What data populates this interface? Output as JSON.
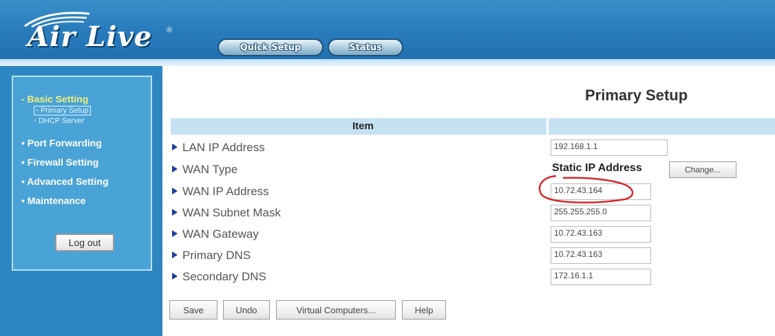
{
  "header": {
    "logo_text": "Air Live",
    "logo_reg": "®",
    "nav": [
      {
        "label": "Quick Setup"
      },
      {
        "label": "Status"
      }
    ]
  },
  "sidebar": {
    "menu": [
      {
        "label": "- Basic Setting",
        "active": true
      },
      {
        "label": "• Port Forwarding"
      },
      {
        "label": "• Firewall Setting"
      },
      {
        "label": "• Advanced Setting"
      },
      {
        "label": "• Maintenance"
      }
    ],
    "submenu": [
      {
        "label": "◦ Primary Setup",
        "selected": true
      },
      {
        "label": "◦ DHCP Server"
      }
    ],
    "logout_label": "Log out"
  },
  "main": {
    "title": "Primary Setup",
    "table_header": "Item",
    "rows": [
      {
        "label": "LAN IP Address",
        "value": "192.168.1.1"
      },
      {
        "label": "WAN Type",
        "value": "Static IP Address"
      },
      {
        "label": "WAN IP Address",
        "value": "10.72.43.164"
      },
      {
        "label": "WAN Subnet Mask",
        "value": "255.255.255.0"
      },
      {
        "label": "WAN Gateway",
        "value": "10.72.43.163"
      },
      {
        "label": "Primary DNS",
        "value": "10.72.43.163"
      },
      {
        "label": "Secondary DNS",
        "value": "172.16.1.1"
      }
    ],
    "change_label": "Change...",
    "buttons": [
      {
        "label": "Save"
      },
      {
        "label": "Undo"
      },
      {
        "label": "Virtual Computers..."
      },
      {
        "label": "Help"
      }
    ]
  },
  "colors": {
    "header_blue": "#2a7dbd",
    "sidebar_blue": "#4aa3d6",
    "active_menu": "#f3ef7a",
    "table_header": "#c6e2f2",
    "annotation_red": "#d8262a"
  }
}
